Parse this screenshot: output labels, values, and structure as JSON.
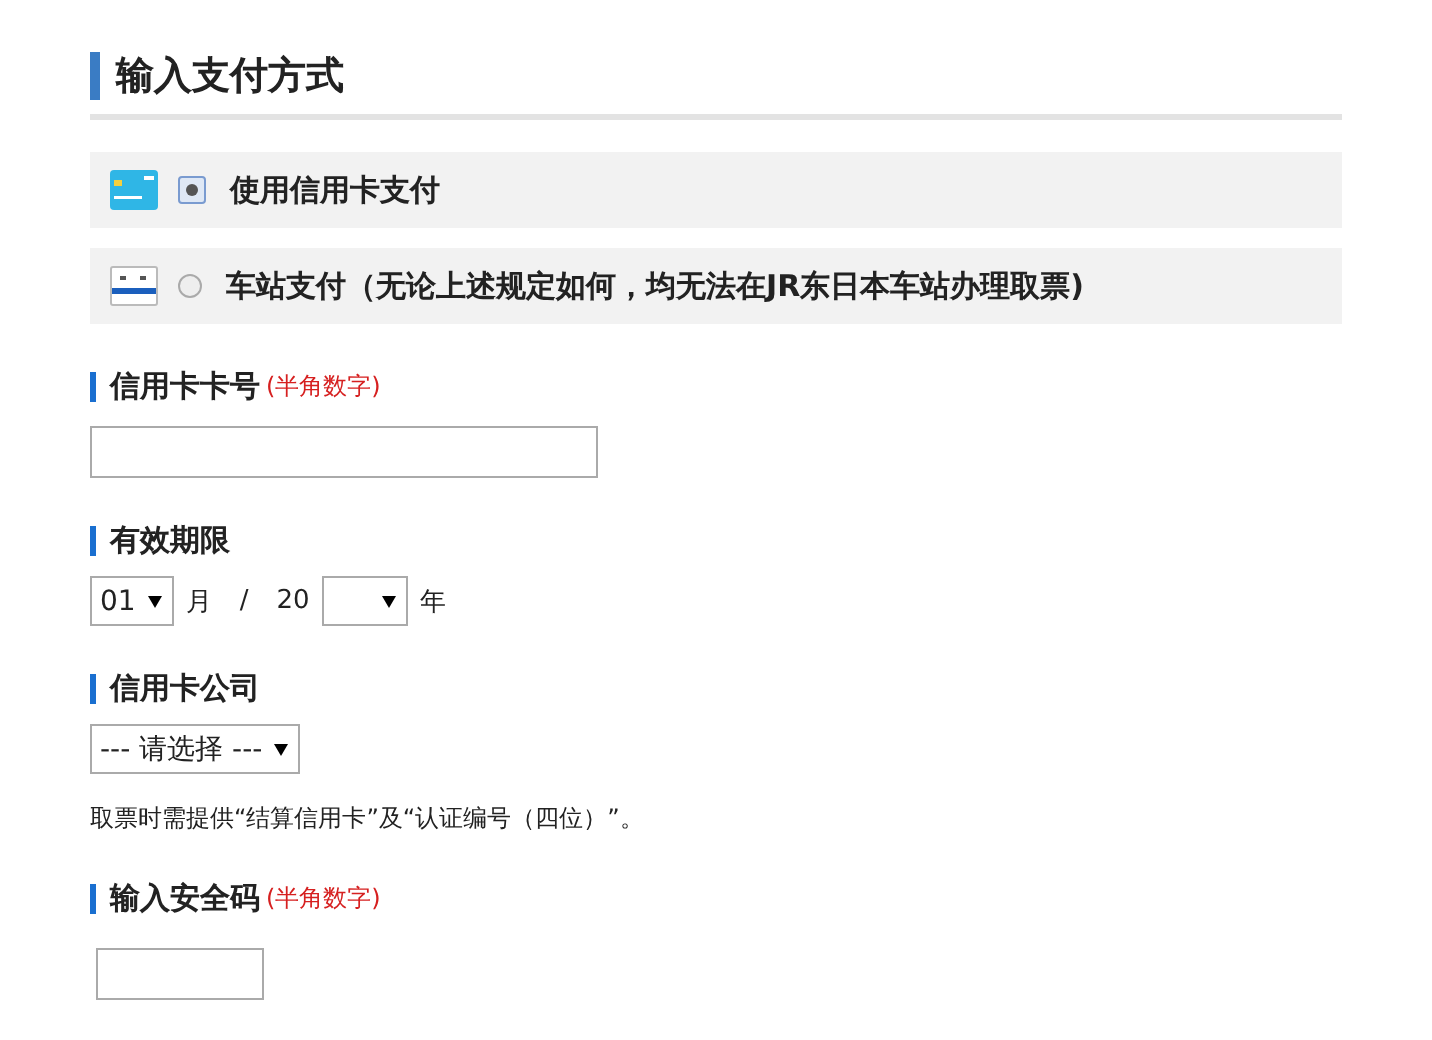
{
  "title": "输入支付方式",
  "payment_options": [
    {
      "kind": "card",
      "label": "使用信用卡支付",
      "selected": true
    },
    {
      "kind": "station",
      "label": "车站支付（无论上述规定如何，均无法在JR东日本车站办理取票)",
      "selected": false
    }
  ],
  "card_number": {
    "label": "信用卡卡号",
    "note": "(半角数字)"
  },
  "expiry": {
    "label": "有效期限",
    "month": "01",
    "month_unit": "月",
    "separator": "/",
    "year_prefix": "20",
    "year_unit": "年"
  },
  "company": {
    "label": "信用卡公司",
    "value": "--- 请选择 ---",
    "notice": "取票时需提供“结算信用卡”及“认证编号（四位）”。"
  },
  "security": {
    "label": "输入安全码",
    "note": "(半角数字)"
  }
}
